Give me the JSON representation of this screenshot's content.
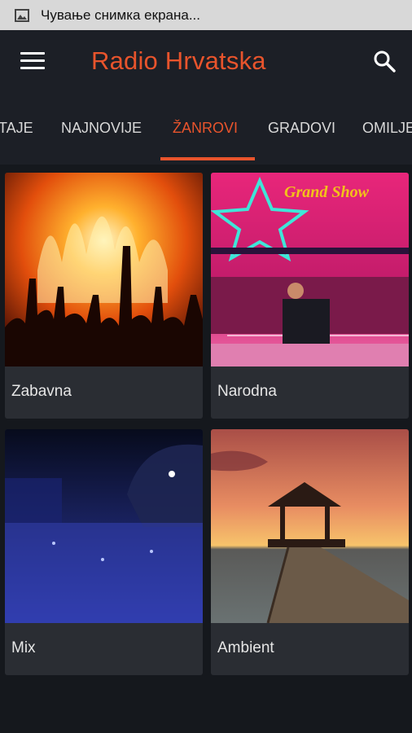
{
  "status_bar": {
    "text": "Чување снимка екрана..."
  },
  "app_bar": {
    "title": "Radio Hrvatska",
    "menu_icon": "hamburger-icon",
    "search_icon": "search-icon"
  },
  "tabs": [
    {
      "label": "TAJE"
    },
    {
      "label": "NAJNOVIJE"
    },
    {
      "label": "ŽANROVI",
      "active": true
    },
    {
      "label": "GRADOVI"
    },
    {
      "label": "OMILJE"
    }
  ],
  "colors": {
    "accent": "#e8542c",
    "background": "#1c1f26",
    "card": "#2a2d33"
  },
  "genres": [
    {
      "label": "Zabavna",
      "image_text": ""
    },
    {
      "label": "Narodna",
      "image_text": "Grand Show"
    },
    {
      "label": "Mix",
      "image_text": ""
    },
    {
      "label": "Ambient",
      "image_text": ""
    }
  ]
}
